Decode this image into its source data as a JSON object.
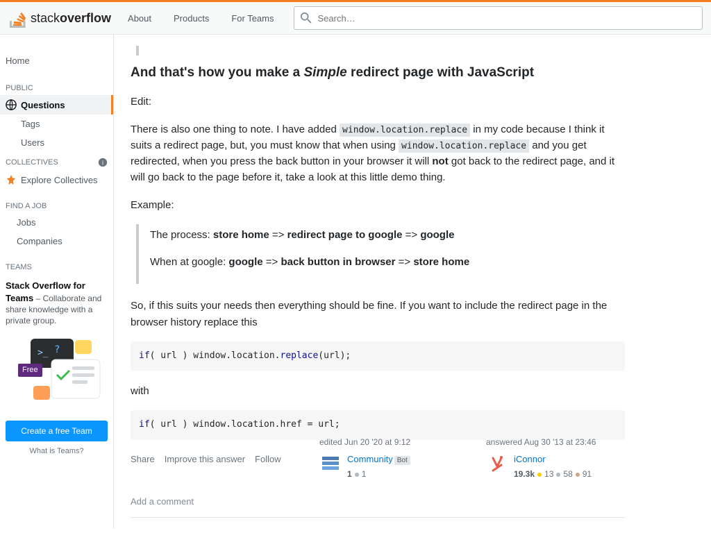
{
  "topnav": {
    "about": "About",
    "products": "Products",
    "for_teams": "For Teams",
    "search_placeholder": "Search…"
  },
  "logo": {
    "stack": "stack",
    "overflow": "overflow"
  },
  "sidebar": {
    "home": "Home",
    "public": "PUBLIC",
    "questions": "Questions",
    "tags": "Tags",
    "users": "Users",
    "collectives": "COLLECTIVES",
    "explore": "Explore Collectives",
    "find_job": "FIND A JOB",
    "jobs": "Jobs",
    "companies": "Companies",
    "teams": "TEAMS",
    "teams_title": "Stack Overflow for Teams",
    "teams_desc": " – Collaborate and share knowledge with a private group.",
    "free": "Free",
    "create_team": "Create a free Team",
    "what_teams": "What is Teams?"
  },
  "answer": {
    "heading_pre": "And that's how you make a ",
    "heading_em": "Simple",
    "heading_post": " redirect page with JavaScript",
    "edit_label": "Edit:",
    "para1_a": "There is also one thing to note. I have added ",
    "code1": "window.location.replace",
    "para1_b": " in my code because I think it suits a redirect page, but, you must know that when using ",
    "code2": "window.location.replace",
    "para1_c": " and you get redirected, when you press the back button in your browser it will ",
    "not": "not",
    "para1_d": " got back to the redirect page, and it will go back to the page before it, take a look at this little demo thing.",
    "example": "Example:",
    "bq1_a": "The process: ",
    "bq1_b": "store home",
    "bq1_c": " => ",
    "bq1_d": "redirect page to google",
    "bq1_e": " => ",
    "bq1_f": "google",
    "bq2_a": "When at google: ",
    "bq2_b": "google",
    "bq2_c": " => ",
    "bq2_d": "back button in browser",
    "bq2_e": " => ",
    "bq2_f": "store home",
    "para2": "So, if this suits your needs then everything should be fine. If you want to include the redirect page in the browser history replace this",
    "with": "with",
    "menu": {
      "share": "Share",
      "improve": "Improve this answer",
      "follow": "Follow"
    },
    "edited": {
      "when": "edited Jun 20 '20 at 9:12",
      "name": "Community",
      "bot": "Bot",
      "rep": "1",
      "silver": "1"
    },
    "answered": {
      "when": "answered Aug 30 '13 at 23:46",
      "name": "iConnor",
      "rep": "19.3k",
      "gold": "13",
      "silver": "58",
      "bronze": "91"
    },
    "add_comment": "Add a comment"
  }
}
